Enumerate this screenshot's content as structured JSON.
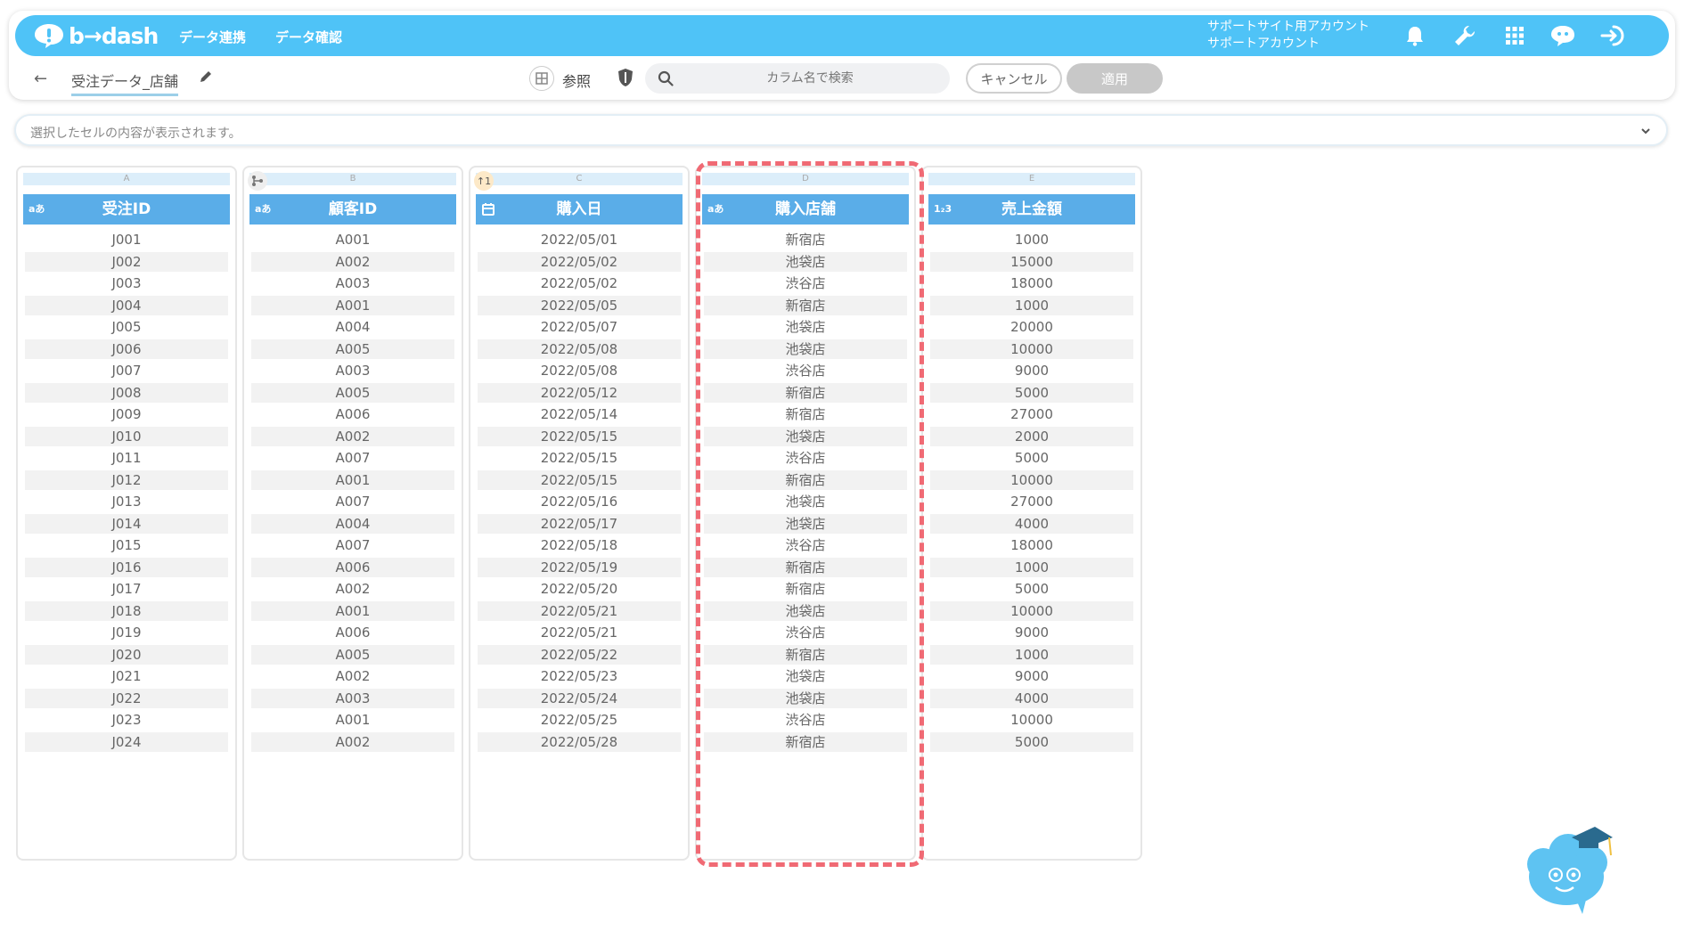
{
  "app": {
    "logo_text": "b→dash",
    "nav_links": [
      "データ連携",
      "データ確認"
    ],
    "account_line1": "サポートサイト用アカウント",
    "account_line2": "サポートアカウント"
  },
  "toolbar": {
    "back_icon": "arrow-left-icon",
    "title": "受注データ_店舗",
    "ref_label": "参照",
    "search_placeholder": "カラム名で検索",
    "cancel_label": "キャンセル",
    "apply_label": "適用"
  },
  "cellbar": {
    "placeholder": "選択したセルの内容が表示されます。"
  },
  "columns": [
    {
      "letter": "A",
      "type": "aあ",
      "name": "受注ID"
    },
    {
      "letter": "B",
      "type": "aあ",
      "name": "顧客ID"
    },
    {
      "letter": "C",
      "type": "cal",
      "name": "購入日",
      "badge": "↑1"
    },
    {
      "letter": "D",
      "type": "aあ",
      "name": "購入店舗"
    },
    {
      "letter": "E",
      "type": "1₂3",
      "name": "売上金額"
    }
  ],
  "rows": [
    [
      "J001",
      "A001",
      "2022/05/01",
      "新宿店",
      "1000"
    ],
    [
      "J002",
      "A002",
      "2022/05/02",
      "池袋店",
      "15000"
    ],
    [
      "J003",
      "A003",
      "2022/05/02",
      "渋谷店",
      "18000"
    ],
    [
      "J004",
      "A001",
      "2022/05/05",
      "新宿店",
      "1000"
    ],
    [
      "J005",
      "A004",
      "2022/05/07",
      "池袋店",
      "20000"
    ],
    [
      "J006",
      "A005",
      "2022/05/08",
      "池袋店",
      "10000"
    ],
    [
      "J007",
      "A003",
      "2022/05/08",
      "渋谷店",
      "9000"
    ],
    [
      "J008",
      "A005",
      "2022/05/12",
      "新宿店",
      "5000"
    ],
    [
      "J009",
      "A006",
      "2022/05/14",
      "新宿店",
      "27000"
    ],
    [
      "J010",
      "A002",
      "2022/05/15",
      "池袋店",
      "2000"
    ],
    [
      "J011",
      "A007",
      "2022/05/15",
      "渋谷店",
      "5000"
    ],
    [
      "J012",
      "A001",
      "2022/05/15",
      "新宿店",
      "10000"
    ],
    [
      "J013",
      "A007",
      "2022/05/16",
      "池袋店",
      "27000"
    ],
    [
      "J014",
      "A004",
      "2022/05/17",
      "池袋店",
      "4000"
    ],
    [
      "J015",
      "A007",
      "2022/05/18",
      "渋谷店",
      "18000"
    ],
    [
      "J016",
      "A006",
      "2022/05/19",
      "新宿店",
      "1000"
    ],
    [
      "J017",
      "A002",
      "2022/05/20",
      "新宿店",
      "5000"
    ],
    [
      "J018",
      "A001",
      "2022/05/21",
      "池袋店",
      "10000"
    ],
    [
      "J019",
      "A006",
      "2022/05/21",
      "渋谷店",
      "9000"
    ],
    [
      "J020",
      "A005",
      "2022/05/22",
      "新宿店",
      "1000"
    ],
    [
      "J021",
      "A002",
      "2022/05/23",
      "池袋店",
      "9000"
    ],
    [
      "J022",
      "A003",
      "2022/05/24",
      "池袋店",
      "4000"
    ],
    [
      "J023",
      "A001",
      "2022/05/25",
      "渋谷店",
      "10000"
    ],
    [
      "J024",
      "A002",
      "2022/05/28",
      "新宿店",
      "5000"
    ]
  ],
  "colors": {
    "navbar": "#4fc3f7",
    "header": "#5aade8",
    "highlight": "#f06a74"
  }
}
